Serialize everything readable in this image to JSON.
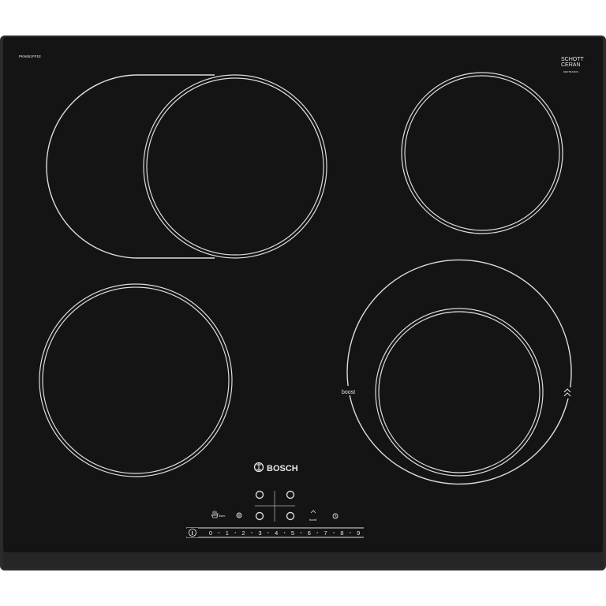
{
  "model_code": "PKN651FP1E",
  "glass": {
    "brand_line1": "SCHOTT",
    "brand_line2": "CERAN",
    "sub_code": "DENTRANDS"
  },
  "brand": "BOSCH",
  "zones": {
    "extended_label": "boost",
    "boost_icon": "double-chevron-up-icon"
  },
  "controls": {
    "childlock_label": "3sec",
    "boost_label": "boost",
    "power_symbol": "I",
    "levels": [
      "0",
      "1",
      "2",
      "3",
      "4",
      "5",
      "6",
      "7",
      "8",
      "9"
    ],
    "icons": [
      "hand-lock-icon",
      "wipe-protect-icon",
      "boost-icon",
      "timer-icon",
      "power-icon"
    ]
  },
  "colors": {
    "glass": "#141414",
    "frame": "#2b2b2b",
    "print": "#e0e0e0"
  }
}
